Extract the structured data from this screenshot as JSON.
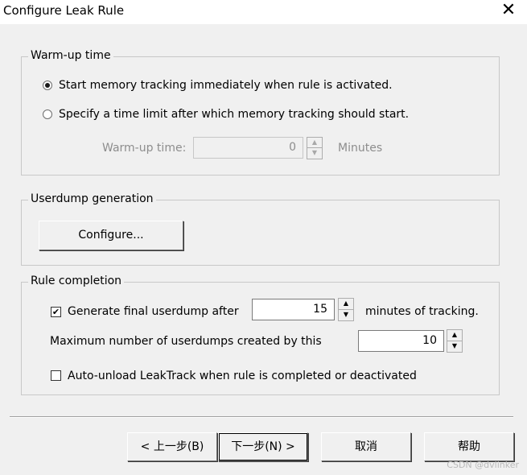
{
  "window": {
    "title": "Configure Leak Rule",
    "close_icon": "close-icon"
  },
  "warmup": {
    "group_label": "Warm-up time",
    "option_immediate": "Start memory tracking immediately when rule is activated.",
    "option_timelimit": "Specify a time limit after which memory tracking should start.",
    "selected": "immediate",
    "time_label": "Warm-up time:",
    "time_value": "0",
    "time_unit": "Minutes"
  },
  "userdump": {
    "group_label": "Userdump generation",
    "configure_button": "Configure..."
  },
  "completion": {
    "group_label": "Rule completion",
    "generate_label": "Generate final userdump after",
    "generate_checked": true,
    "generate_value": "15",
    "generate_suffix": "minutes of tracking.",
    "max_label": "Maximum number of userdumps created by this",
    "max_value": "10",
    "autounload_label": "Auto-unload LeakTrack when rule is completed or deactivated",
    "autounload_checked": false
  },
  "buttons": {
    "back": "< 上一步(B)",
    "next": "下一步(N) >",
    "cancel": "取消",
    "help": "帮助"
  },
  "watermark": "CSDN @dvlinker"
}
